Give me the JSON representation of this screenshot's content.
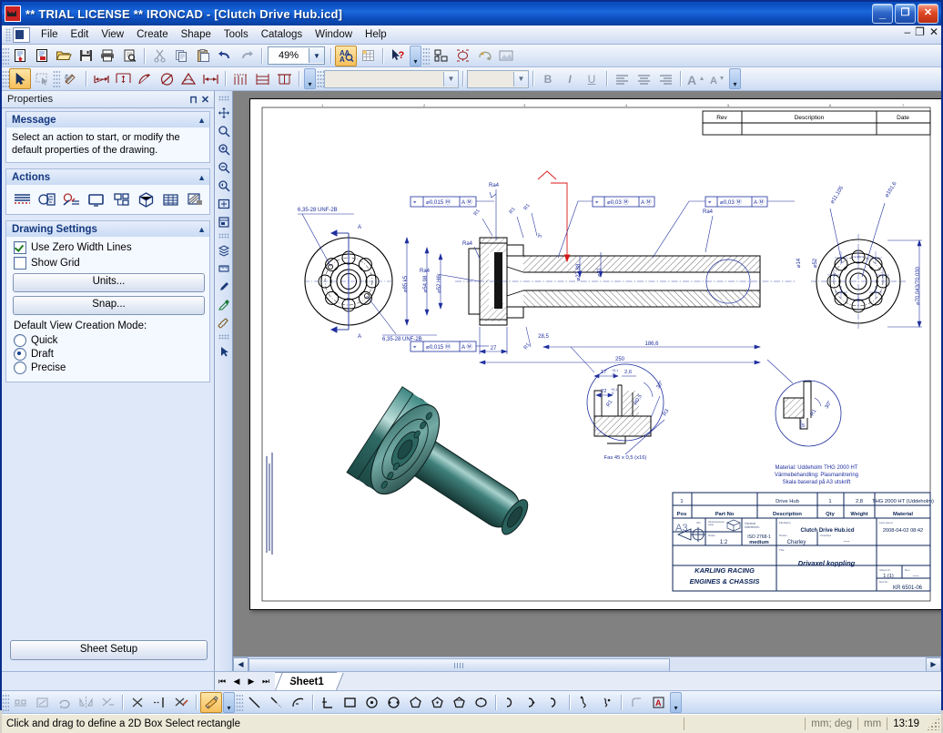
{
  "window": {
    "title": "** TRIAL LICENSE ** IRONCAD - [Clutch Drive Hub.icd]",
    "app_icon": "ironcad-logo-icon",
    "minimize": "_",
    "maximize": "❐",
    "close": "✕",
    "doc_minimize": "–",
    "doc_restore": "❐",
    "doc_close": "✕"
  },
  "menu": {
    "items": [
      {
        "label": "File",
        "accel": "F"
      },
      {
        "label": "Edit",
        "accel": "E"
      },
      {
        "label": "View",
        "accel": "V"
      },
      {
        "label": "Create",
        "accel": "C"
      },
      {
        "label": "Shape",
        "accel": "S"
      },
      {
        "label": "Tools",
        "accel": "T"
      },
      {
        "label": "Catalogs",
        "accel": "C"
      },
      {
        "label": "Window",
        "accel": "W"
      },
      {
        "label": "Help",
        "accel": "H"
      }
    ]
  },
  "toolbar": {
    "zoom_value": "49%",
    "font_combo_value": "",
    "size_combo_value": "",
    "standard_icons": [
      "new-scene-icon",
      "new-drawing-icon",
      "open-icon",
      "save-icon",
      "print-icon",
      "print-preview-icon",
      "cut-icon",
      "copy-icon",
      "paste-icon",
      "undo-icon",
      "redo-icon"
    ],
    "view_icons": [
      "find-icon",
      "grid-icon",
      "help-pointer-icon"
    ],
    "assembly_icons": [
      "assembly-icon",
      "constraint-icon",
      "rotate-icon",
      "render-icon"
    ],
    "scene_icons": [
      "scene-browser-icon",
      "pie-icon",
      "half-pie-icon",
      "color-icon",
      "box-icon"
    ],
    "misc_icons": [
      "align-icon",
      "explode-icon",
      "explode-red-icon",
      "explode-red2-icon",
      "window-icon"
    ],
    "right_icons": [
      "axis-icon",
      "target-icon",
      "anchor-icon",
      "light-icon",
      "spotlight-icon",
      "globe-icon",
      "table-icon",
      "clock-icon",
      "text-a-icon",
      "sqrt-icon",
      "surface-icon"
    ],
    "draw_icons": [
      "select-arrow-icon",
      "select-box-icon",
      "sketch-icon",
      "linear-dim-icon",
      "baseline-dim-icon",
      "arc-dim-icon",
      "diameter-dim-icon",
      "angular-dim-icon",
      "chain-dim-icon",
      "ordinate-dim-icon",
      "stack-dim-icon",
      "datum-dim-icon"
    ],
    "text_format": {
      "bold": "B",
      "italic": "I",
      "underline": "U",
      "align_left": "align-left-icon",
      "align_center": "align-center-icon",
      "align_right": "align-right-icon",
      "grow_font": "grow-font-icon",
      "shrink_font": "shrink-font-icon"
    }
  },
  "left_vtools": [
    "pan-icon",
    "zoom-window-icon",
    "zoom-in-icon",
    "zoom-out-icon",
    "zoom-prev-icon",
    "zoom-fit-icon",
    "zoom-sheet-icon",
    "layers-icon",
    "ruler-icon",
    "pen-icon",
    "eyedropper-icon",
    "brush-icon",
    "arrow-icon"
  ],
  "panel": {
    "title": "Properties",
    "pin_icon": "pin-icon",
    "close_icon": "close-icon",
    "groups": [
      {
        "title": "Message",
        "collapse_icon": "chevron-up-icon",
        "text": "Select an action to start, or modify the default properties of the drawing."
      },
      {
        "title": "Actions",
        "collapse_icon": "chevron-up-icon",
        "buttons": [
          "create-views-icon",
          "detail-view-icon",
          "section-view-icon",
          "blank-view-icon",
          "exploded-view-icon",
          "3d-view-icon",
          "bom-table-icon",
          "hatch-icon"
        ]
      },
      {
        "title": "Drawing Settings",
        "collapse_icon": "chevron-up-icon",
        "checkboxes": [
          {
            "label": "Use Zero Width Lines",
            "checked": true
          },
          {
            "label": "Show Grid",
            "checked": false
          }
        ],
        "buttons": [
          {
            "label": "Units..."
          },
          {
            "label": "Snap..."
          }
        ],
        "mode_label": "Default View Creation Mode:",
        "modes": [
          {
            "label": "Quick",
            "selected": false
          },
          {
            "label": "Draft",
            "selected": true
          },
          {
            "label": "Precise",
            "selected": false
          }
        ]
      }
    ],
    "footer_button": "Sheet Setup"
  },
  "tabs": {
    "nav_first": "⏮",
    "nav_prev": "◀",
    "nav_next": "▶",
    "nav_last": "⏭",
    "sheets": [
      {
        "label": "Sheet1",
        "active": true
      }
    ]
  },
  "bottom_toolbar": {
    "group1": [
      "array-icon",
      "frame-icon",
      "rotate2-icon",
      "mirror-icon",
      "trim-extend-icon"
    ],
    "group2": [
      "trim-icon",
      "extend-icon",
      "trim-corner-icon"
    ],
    "group3_active": "box-select-icon",
    "group4": [
      "line-icon",
      "polyline-icon",
      "arc3pt-icon"
    ],
    "group5": [
      "corner-icon",
      "rectangle-icon",
      "circle-center-icon",
      "circle-2pt-icon",
      "polygon-icon",
      "polygon2-icon",
      "polygon3-icon",
      "ellipse-icon"
    ],
    "group6": [
      "spline-icon",
      "bspline-icon",
      "curve-icon"
    ],
    "group7": [
      "point-icon",
      "point2-icon"
    ],
    "group8": [
      "fillet-icon",
      "text-box-icon"
    ]
  },
  "status": {
    "message": "Click and drag to define a 2D Box Select rectangle",
    "units": "mm; deg",
    "units2": "mm",
    "time": "13:19"
  },
  "drawing": {
    "revision_table": {
      "headers": [
        "Rev",
        "Description",
        "Date"
      ],
      "rows": [
        [
          "",
          "",
          ""
        ]
      ]
    },
    "annotations": [
      {
        "text": "6,35-28 UNF-2B"
      },
      {
        "text": "6,35-28 UNF-2B"
      },
      {
        "text": "A"
      },
      {
        "text": "A"
      },
      {
        "text": "Ra4"
      },
      {
        "text": "Ra4"
      },
      {
        "text": "Ra4"
      },
      {
        "text": "Ra4"
      },
      {
        "text": "R1"
      },
      {
        "text": "R1"
      },
      {
        "text": "R1"
      },
      {
        "text": "R1"
      },
      {
        "text": "R3"
      },
      {
        "text": "3°"
      },
      {
        "text": "30°"
      },
      {
        "text": "5"
      },
      {
        "text": "27"
      },
      {
        "text": "28,5"
      },
      {
        "text": "186,6"
      },
      {
        "text": "250"
      },
      {
        "text": "2,6"
      },
      {
        "text": "17"
      },
      {
        "text": "22"
      },
      {
        "text": "Fas 45 x 0,5 (x16)"
      }
    ],
    "gdt_frames": [
      "⌖ | ⌀0,015 Ⓜ | A Ⓜ",
      "⌖ | ⌀0,015 Ⓜ | A Ⓜ",
      "⌖ | ⌀0,03 Ⓜ | A Ⓜ",
      "⌖ | ⌀0,03 Ⓜ | A Ⓜ"
    ],
    "diameters": [
      "⌀85 k5",
      "⌀54,98",
      "⌀52 H6",
      "⌀27,88",
      "⌀31",
      "⌀14",
      "⌀52",
      "⌀11,105",
      "⌀101,6",
      "⌀70,043/70,030"
    ],
    "notes": [
      "Material: Uddeholm THG 2000 HT",
      "Värmebehandling: Plasmanitrering",
      "Skala baserad på A3 utskrift"
    ],
    "title_block": {
      "bom_values": [
        "1",
        "",
        "Drive Hub",
        "1",
        "2,8",
        "THG 2000 HT (Uddeholm)"
      ],
      "bom_headers": [
        "Pos",
        "Part No",
        "Description",
        "Qty",
        "Weight",
        "Material"
      ],
      "sheet_format": "A3",
      "sheet_format_note": "ISO",
      "tolerance_note": "General tolerances:",
      "tolerance_label_small": "Allmäntoleranser enligt:",
      "projection_icon": "first-angle-projection-icon",
      "filename_label": "FileName",
      "filename_value": "Clutch Drive Hub.icd",
      "modified_label": "Last saved",
      "modified_value": "2008-04-02 08:42",
      "scale_label": "Scale",
      "scale_value": "1:2",
      "tolstd_value": "ISO 2768-1\nmedium",
      "drawn_label": "Drawn",
      "drawn_value": "Charley",
      "checked_label": "Checked",
      "checked_value": "----",
      "company_line1": "KARLING RACING",
      "company_line2": "ENGINES & CHASSIS",
      "title_label": "Title",
      "title_value": "Drivaxel koppling",
      "sheet_label": "Sheet Nr",
      "sheet_value": "1 (1)",
      "rev_label": "Rev.",
      "rev_value": "----",
      "docnr_label": "Doc.Nr",
      "docnr_value": "KR 6501-06"
    }
  },
  "colors": {
    "title_blue": "#0a4bbd",
    "accent_orange": "#f7bf5b",
    "drawing_blue": "#1f2f9e",
    "model_teal": "#2f6a66",
    "canvas_gray": "#818181",
    "status_bg": "#ece9d8"
  }
}
